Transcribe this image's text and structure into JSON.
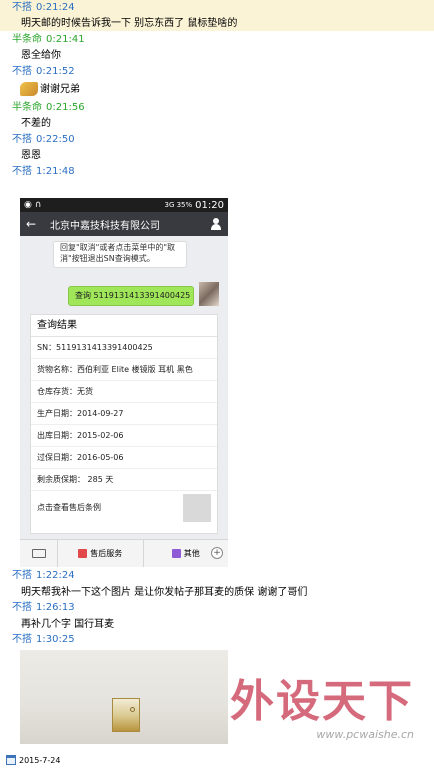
{
  "chat": [
    {
      "name": "不搭",
      "time": "0:21:24",
      "text": "明天邮的时候告诉我一下  别忘东西了 鼠标垫啥的"
    },
    {
      "name": "半条命",
      "time": "0:21:41",
      "text": "恩全给你"
    },
    {
      "name": "不搭",
      "time": "0:21:52",
      "text": "谢谢兄弟"
    },
    {
      "name": "半条命",
      "time": "0:21:56",
      "text": "不差的"
    },
    {
      "name": "不搭",
      "time": "0:22:50",
      "text": "恩恩"
    },
    {
      "name": "不搭",
      "time": "1:21:48",
      "text": ""
    },
    {
      "name": "不搭",
      "time": "1:22:24",
      "text": "明天帮我补一下这个图片 是让你发帖子那耳麦的质保 谢谢了哥们"
    },
    {
      "name": "不搭",
      "time": "1:26:13",
      "text": "再补几个字 国行耳麦"
    },
    {
      "name": "不搭",
      "time": "1:30:25",
      "text": ""
    }
  ],
  "phone": {
    "status_time": "01:20",
    "status_right": "3G  35%",
    "title": "北京中嘉技科技有限公司",
    "bubble_in": "回复\"取消\"或者点击菜单中的\"取消\"按钮退出SN查询模式。",
    "bubble_out": "查询 5119131413391400425",
    "card": {
      "title": "查询结果",
      "rows": [
        "SN：5119131413391400425",
        "货物名称：西伯利亚 Elite 楼镜版 耳机 黑色",
        "仓库存货：无货",
        "生产日期：2014-09-27",
        "出库日期：2015-02-06",
        "过保日期：2016-05-06",
        "剩余质保期：  285 天"
      ],
      "more": "点击查看售后条例"
    },
    "bottom": {
      "service": "售后服务",
      "other": "其他"
    }
  },
  "watermark": {
    "text": "外设天下",
    "url": "www.pcwaishe.cn"
  },
  "footer": {
    "date": "2015-7-24"
  },
  "colors": {
    "sender_blue": "#2b6fc2",
    "sender_green": "#2ba52b",
    "highlight": "#fbf3d6",
    "bubble_green": "#9fe658"
  }
}
